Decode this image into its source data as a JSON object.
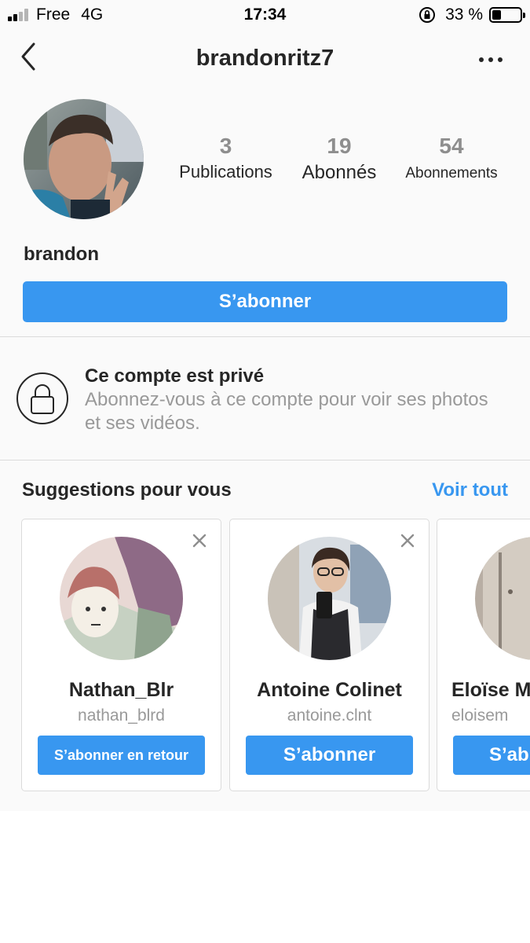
{
  "status_bar": {
    "carrier": "Free",
    "network": "4G",
    "time": "17:34",
    "battery": "33 %",
    "battery_level": 0.33
  },
  "header": {
    "username": "brandonritz7"
  },
  "profile": {
    "display_name": "brandon",
    "stats": {
      "posts_count": "3",
      "posts_label": "Publications",
      "followers_count": "19",
      "followers_label": "Abonnés",
      "following_count": "54",
      "following_label": "Abonnements"
    },
    "follow_label": "S’abonner"
  },
  "private_notice": {
    "title": "Ce compte est privé",
    "description": "Abonnez-vous à ce compte pour voir ses photos et ses vidéos."
  },
  "suggestions": {
    "title": "Suggestions pour vous",
    "see_all": "Voir tout",
    "cards": [
      {
        "name": "Nathan_Blr",
        "handle": "nathan_blrd",
        "button": "S’abonner en retour"
      },
      {
        "name": "Antoine Colinet",
        "handle": "antoine.clnt",
        "button": "S’abonner"
      },
      {
        "name": "Eloïse M",
        "handle": "eloisem",
        "button": "S’ab"
      }
    ]
  },
  "colors": {
    "accent": "#3897f0",
    "text": "#262626",
    "muted": "#999999",
    "background": "#fafafa"
  }
}
